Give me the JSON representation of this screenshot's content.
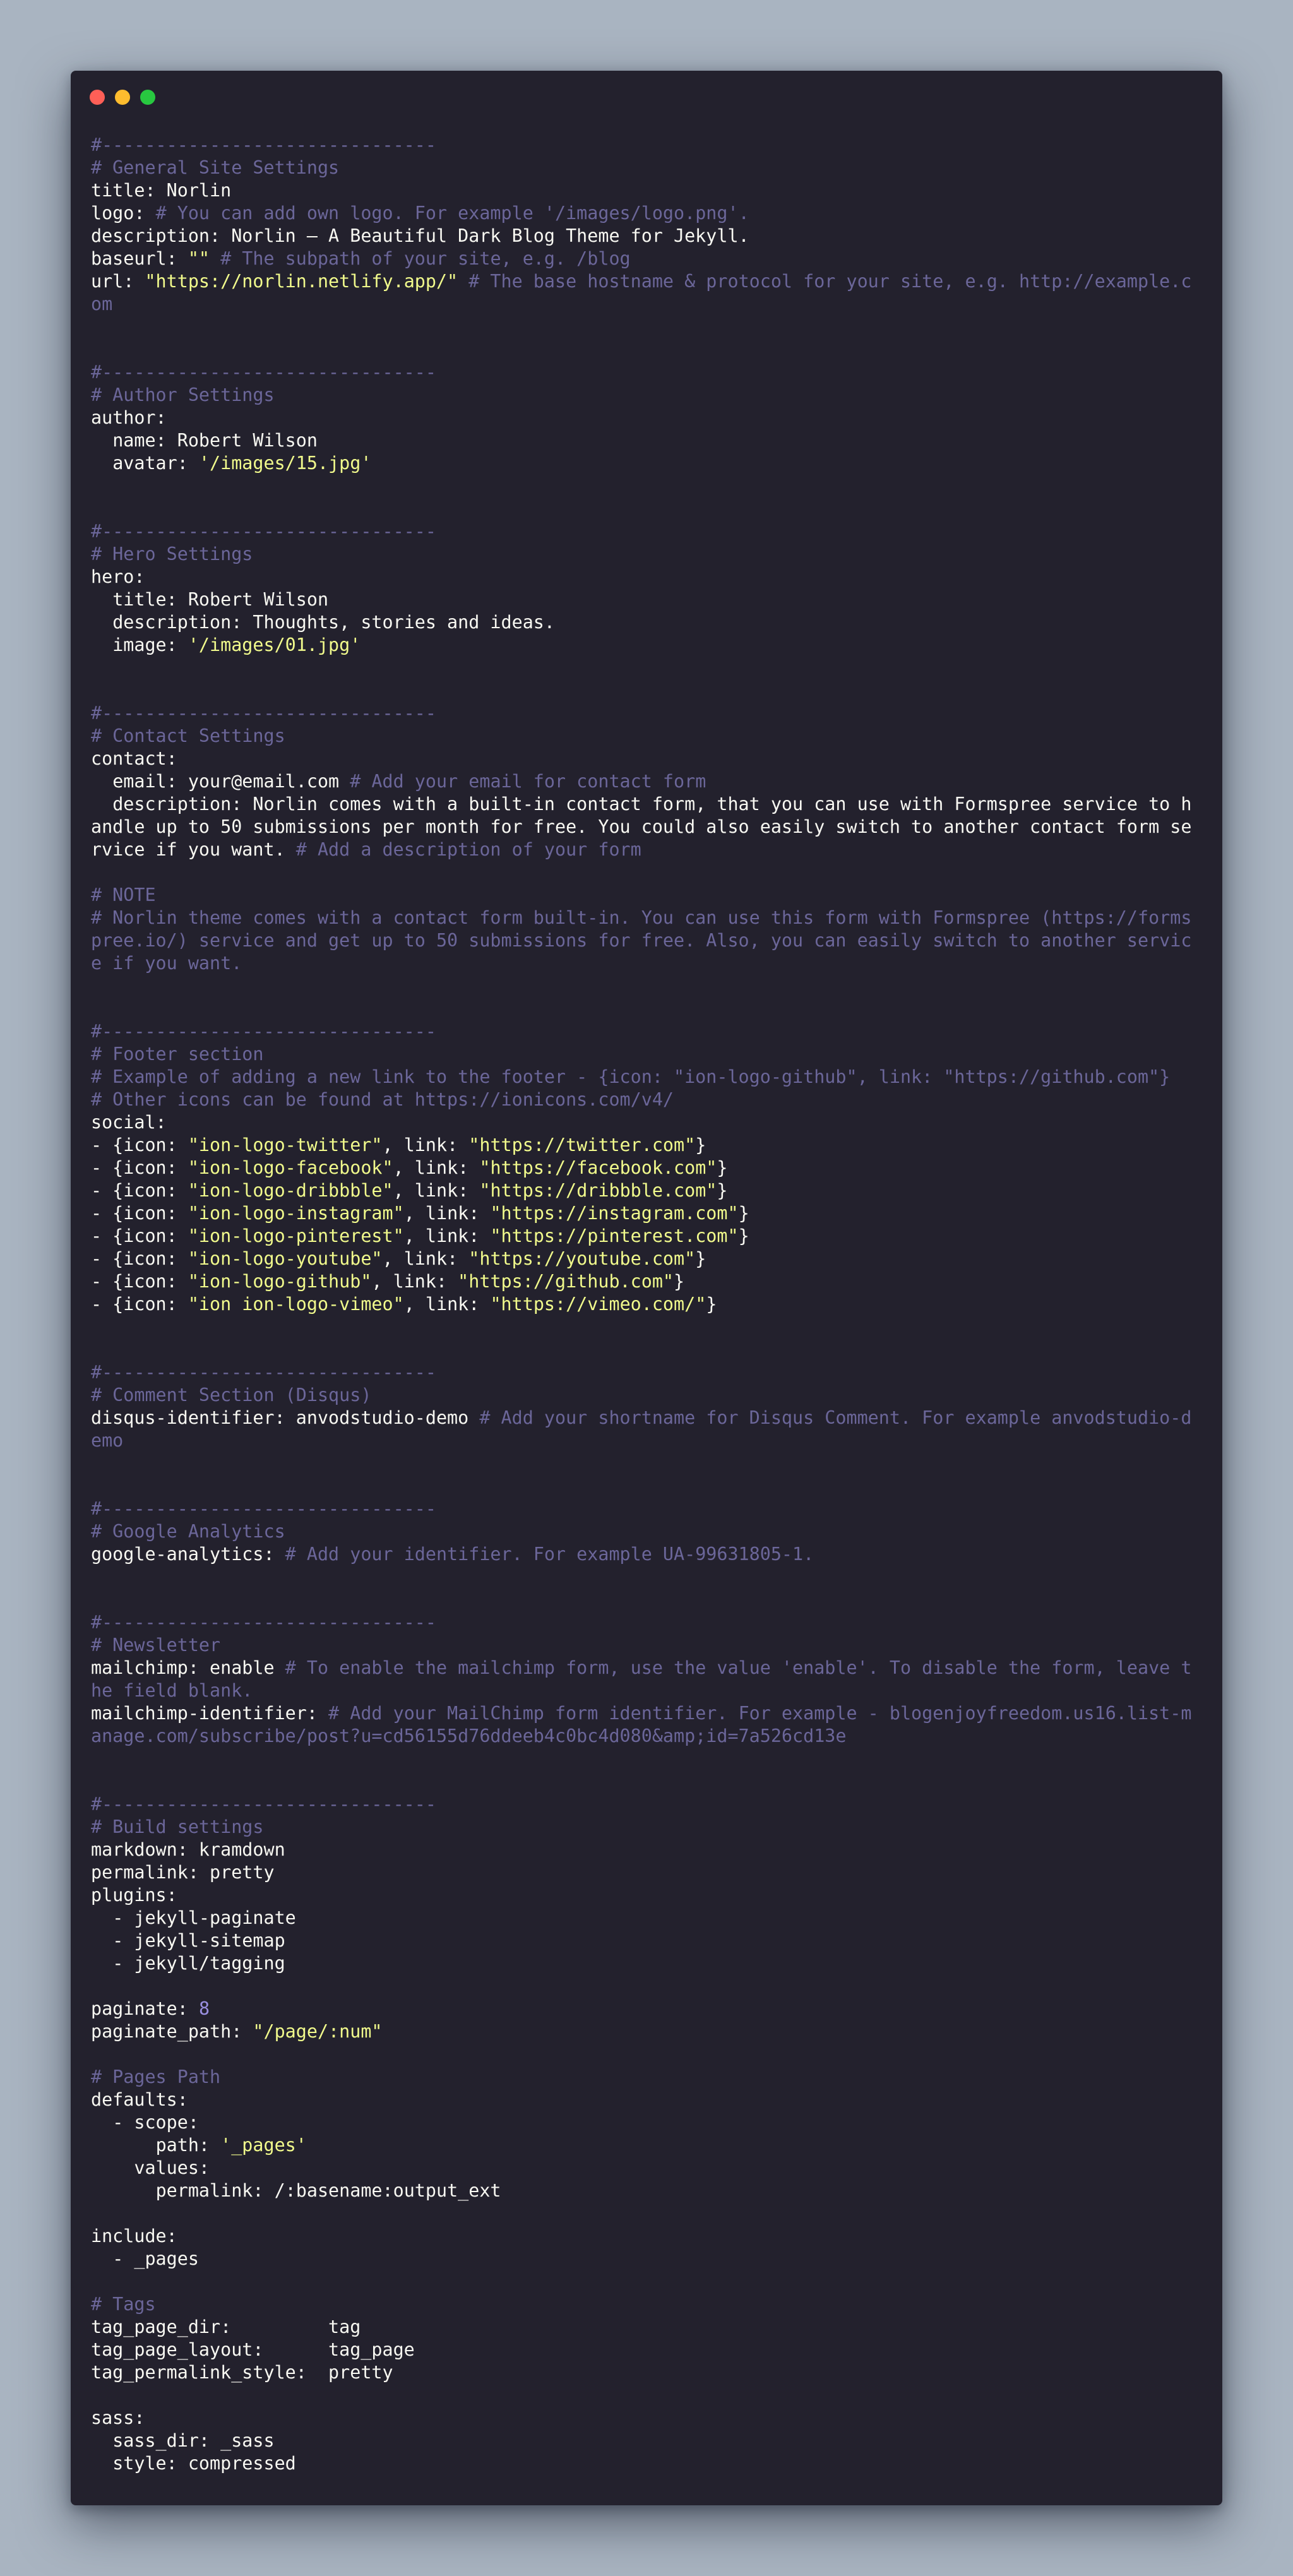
{
  "window": {
    "controls": [
      {
        "name": "close-button",
        "color": "#ff5f57"
      },
      {
        "name": "minimize-button",
        "color": "#febc2e"
      },
      {
        "name": "zoom-button",
        "color": "#28c840"
      }
    ]
  },
  "editor": {
    "colors": {
      "background": "#23212d",
      "text": "#f8f8f2",
      "comment": "#6b6699",
      "string": "#f1fa8c",
      "number": "#9a8fe0"
    },
    "lines": [
      [
        {
          "t": "c",
          "v": "#-------------------------------"
        }
      ],
      [
        {
          "t": "c",
          "v": "# General Site Settings"
        }
      ],
      [
        {
          "t": "t",
          "v": "title: Norlin"
        }
      ],
      [
        {
          "t": "t",
          "v": "logo: "
        },
        {
          "t": "c",
          "v": "# You can add own logo. For example '/images/logo.png'."
        }
      ],
      [
        {
          "t": "t",
          "v": "description: Norlin – A Beautiful Dark Blog Theme for Jekyll."
        }
      ],
      [
        {
          "t": "t",
          "v": "baseurl: "
        },
        {
          "t": "s",
          "v": "\"\""
        },
        {
          "t": "c",
          "v": " # The subpath of your site, e.g. /blog"
        }
      ],
      [
        {
          "t": "t",
          "v": "url: "
        },
        {
          "t": "s",
          "v": "\"https://norlin.netlify.app/\""
        },
        {
          "t": "c",
          "v": " # The base hostname & protocol for your site, e.g. http://example.com"
        }
      ],
      [],
      [],
      [
        {
          "t": "c",
          "v": "#-------------------------------"
        }
      ],
      [
        {
          "t": "c",
          "v": "# Author Settings"
        }
      ],
      [
        {
          "t": "t",
          "v": "author:"
        }
      ],
      [
        {
          "t": "t",
          "v": "  name: Robert Wilson"
        }
      ],
      [
        {
          "t": "t",
          "v": "  avatar: "
        },
        {
          "t": "s",
          "v": "'/images/15.jpg'"
        }
      ],
      [],
      [],
      [
        {
          "t": "c",
          "v": "#-------------------------------"
        }
      ],
      [
        {
          "t": "c",
          "v": "# Hero Settings"
        }
      ],
      [
        {
          "t": "t",
          "v": "hero:"
        }
      ],
      [
        {
          "t": "t",
          "v": "  title: Robert Wilson"
        }
      ],
      [
        {
          "t": "t",
          "v": "  description: Thoughts, stories and ideas."
        }
      ],
      [
        {
          "t": "t",
          "v": "  image: "
        },
        {
          "t": "s",
          "v": "'/images/01.jpg'"
        }
      ],
      [],
      [],
      [
        {
          "t": "c",
          "v": "#-------------------------------"
        }
      ],
      [
        {
          "t": "c",
          "v": "# Contact Settings"
        }
      ],
      [
        {
          "t": "t",
          "v": "contact:"
        }
      ],
      [
        {
          "t": "t",
          "v": "  email: your@email.com "
        },
        {
          "t": "c",
          "v": "# Add your email for contact form"
        }
      ],
      [
        {
          "t": "t",
          "v": "  description: Norlin comes with a built-in contact form, that you can use with Formspree service to handle up to 50 submissions per month for free. You could also easily switch to another contact form service if you want. "
        },
        {
          "t": "c",
          "v": "# Add a description of your form"
        }
      ],
      [],
      [
        {
          "t": "c",
          "v": "# NOTE"
        }
      ],
      [
        {
          "t": "c",
          "v": "# Norlin theme comes with a contact form built-in. You can use this form with Formspree (https://formspree.io/) service and get up to 50 submissions for free. Also, you can easily switch to another service if you want."
        }
      ],
      [],
      [],
      [
        {
          "t": "c",
          "v": "#-------------------------------"
        }
      ],
      [
        {
          "t": "c",
          "v": "# Footer section"
        }
      ],
      [
        {
          "t": "c",
          "v": "# Example of adding a new link to the footer - {icon: \"ion-logo-github\", link: \"https://github.com\"}"
        }
      ],
      [
        {
          "t": "c",
          "v": "# Other icons can be found at https://ionicons.com/v4/"
        }
      ],
      [
        {
          "t": "t",
          "v": "social:"
        }
      ],
      [
        {
          "t": "t",
          "v": "- {icon: "
        },
        {
          "t": "s",
          "v": "\"ion-logo-twitter\""
        },
        {
          "t": "t",
          "v": ", link: "
        },
        {
          "t": "s",
          "v": "\"https://twitter.com\""
        },
        {
          "t": "t",
          "v": "}"
        }
      ],
      [
        {
          "t": "t",
          "v": "- {icon: "
        },
        {
          "t": "s",
          "v": "\"ion-logo-facebook\""
        },
        {
          "t": "t",
          "v": ", link: "
        },
        {
          "t": "s",
          "v": "\"https://facebook.com\""
        },
        {
          "t": "t",
          "v": "}"
        }
      ],
      [
        {
          "t": "t",
          "v": "- {icon: "
        },
        {
          "t": "s",
          "v": "\"ion-logo-dribbble\""
        },
        {
          "t": "t",
          "v": ", link: "
        },
        {
          "t": "s",
          "v": "\"https://dribbble.com\""
        },
        {
          "t": "t",
          "v": "}"
        }
      ],
      [
        {
          "t": "t",
          "v": "- {icon: "
        },
        {
          "t": "s",
          "v": "\"ion-logo-instagram\""
        },
        {
          "t": "t",
          "v": ", link: "
        },
        {
          "t": "s",
          "v": "\"https://instagram.com\""
        },
        {
          "t": "t",
          "v": "}"
        }
      ],
      [
        {
          "t": "t",
          "v": "- {icon: "
        },
        {
          "t": "s",
          "v": "\"ion-logo-pinterest\""
        },
        {
          "t": "t",
          "v": ", link: "
        },
        {
          "t": "s",
          "v": "\"https://pinterest.com\""
        },
        {
          "t": "t",
          "v": "}"
        }
      ],
      [
        {
          "t": "t",
          "v": "- {icon: "
        },
        {
          "t": "s",
          "v": "\"ion-logo-youtube\""
        },
        {
          "t": "t",
          "v": ", link: "
        },
        {
          "t": "s",
          "v": "\"https://youtube.com\""
        },
        {
          "t": "t",
          "v": "}"
        }
      ],
      [
        {
          "t": "t",
          "v": "- {icon: "
        },
        {
          "t": "s",
          "v": "\"ion-logo-github\""
        },
        {
          "t": "t",
          "v": ", link: "
        },
        {
          "t": "s",
          "v": "\"https://github.com\""
        },
        {
          "t": "t",
          "v": "}"
        }
      ],
      [
        {
          "t": "t",
          "v": "- {icon: "
        },
        {
          "t": "s",
          "v": "\"ion ion-logo-vimeo\""
        },
        {
          "t": "t",
          "v": ", link: "
        },
        {
          "t": "s",
          "v": "\"https://vimeo.com/\""
        },
        {
          "t": "t",
          "v": "}"
        }
      ],
      [],
      [],
      [
        {
          "t": "c",
          "v": "#-------------------------------"
        }
      ],
      [
        {
          "t": "c",
          "v": "# Comment Section (Disqus)"
        }
      ],
      [
        {
          "t": "t",
          "v": "disqus-identifier: anvodstudio-demo "
        },
        {
          "t": "c",
          "v": "# Add your shortname for Disqus Comment. For example anvodstudio-demo"
        }
      ],
      [],
      [],
      [
        {
          "t": "c",
          "v": "#-------------------------------"
        }
      ],
      [
        {
          "t": "c",
          "v": "# Google Analytics"
        }
      ],
      [
        {
          "t": "t",
          "v": "google-analytics: "
        },
        {
          "t": "c",
          "v": "# Add your identifier. For example UA-99631805-1."
        }
      ],
      [],
      [],
      [
        {
          "t": "c",
          "v": "#-------------------------------"
        }
      ],
      [
        {
          "t": "c",
          "v": "# Newsletter"
        }
      ],
      [
        {
          "t": "t",
          "v": "mailchimp: enable "
        },
        {
          "t": "c",
          "v": "# To enable the mailchimp form, use the value 'enable'. To disable the form, leave the field blank."
        }
      ],
      [
        {
          "t": "t",
          "v": "mailchimp-identifier: "
        },
        {
          "t": "c",
          "v": "# Add your MailChimp form identifier. For example - blogenjoyfreedom.us16.list-manage.com/subscribe/post?u=cd56155d76ddeeb4c0bc4d080&amp;id=7a526cd13e"
        }
      ],
      [],
      [],
      [
        {
          "t": "c",
          "v": "#-------------------------------"
        }
      ],
      [
        {
          "t": "c",
          "v": "# Build settings"
        }
      ],
      [
        {
          "t": "t",
          "v": "markdown: kramdown"
        }
      ],
      [
        {
          "t": "t",
          "v": "permalink: pretty"
        }
      ],
      [
        {
          "t": "t",
          "v": "plugins:"
        }
      ],
      [
        {
          "t": "t",
          "v": "  - jekyll-paginate"
        }
      ],
      [
        {
          "t": "t",
          "v": "  - jekyll-sitemap"
        }
      ],
      [
        {
          "t": "t",
          "v": "  - jekyll/tagging"
        }
      ],
      [],
      [
        {
          "t": "t",
          "v": "paginate: "
        },
        {
          "t": "n",
          "v": "8"
        }
      ],
      [
        {
          "t": "t",
          "v": "paginate_path: "
        },
        {
          "t": "s",
          "v": "\"/page/:num\""
        }
      ],
      [],
      [
        {
          "t": "c",
          "v": "# Pages Path"
        }
      ],
      [
        {
          "t": "t",
          "v": "defaults:"
        }
      ],
      [
        {
          "t": "t",
          "v": "  - scope:"
        }
      ],
      [
        {
          "t": "t",
          "v": "      path: "
        },
        {
          "t": "s",
          "v": "'_pages'"
        }
      ],
      [
        {
          "t": "t",
          "v": "    values:"
        }
      ],
      [
        {
          "t": "t",
          "v": "      permalink: /:basename:output_ext"
        }
      ],
      [],
      [
        {
          "t": "t",
          "v": "include:"
        }
      ],
      [
        {
          "t": "t",
          "v": "  - _pages"
        }
      ],
      [],
      [
        {
          "t": "c",
          "v": "# Tags"
        }
      ],
      [
        {
          "t": "t",
          "v": "tag_page_dir:         tag"
        }
      ],
      [
        {
          "t": "t",
          "v": "tag_page_layout:      tag_page"
        }
      ],
      [
        {
          "t": "t",
          "v": "tag_permalink_style:  pretty"
        }
      ],
      [],
      [
        {
          "t": "t",
          "v": "sass:"
        }
      ],
      [
        {
          "t": "t",
          "v": "  sass_dir: _sass"
        }
      ],
      [
        {
          "t": "t",
          "v": "  style: compressed"
        }
      ]
    ]
  }
}
